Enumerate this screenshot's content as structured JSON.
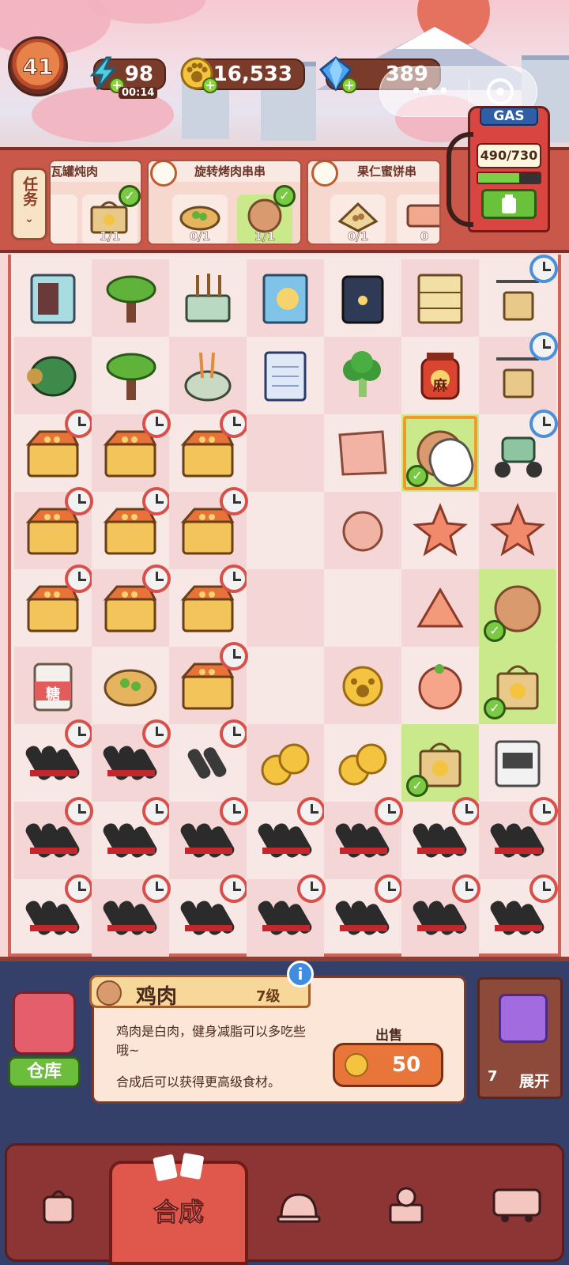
{
  "resources": {
    "level": "41",
    "energy": "98",
    "energy_timer": "00:14",
    "coins": "16,533",
    "gems": "389"
  },
  "gas": {
    "title": "GAS",
    "value": "490/730",
    "fill": 0.67
  },
  "tasks": {
    "tab_label": "任务",
    "orders": [
      {
        "name": "瓦罐炖肉",
        "slots": [
          {
            "count": "",
            "ready": false
          },
          {
            "count": "1/1",
            "ready": true
          }
        ]
      },
      {
        "name": "旋转烤肉串串",
        "slots": [
          {
            "count": "0/1",
            "ready": false
          },
          {
            "count": "1/1",
            "ready": true
          }
        ]
      },
      {
        "name": "果仁蜜饼串",
        "slots": [
          {
            "count": "0/1",
            "ready": false
          },
          {
            "count": "0",
            "ready": false
          }
        ]
      }
    ]
  },
  "board": {
    "rows": [
      [
        "fridge",
        "tree",
        "skewer-machine",
        "recipe-book",
        "chef-hat-box",
        "cabinet",
        "drone"
      ],
      [
        "barrel",
        "tree",
        "skewer-pot",
        "notepad",
        "broccoli",
        "jar",
        "drone"
      ],
      [
        "box",
        "box",
        "box",
        "",
        "meat-slice",
        "meatball-selected",
        "scooter"
      ],
      [
        "box",
        "box",
        "box",
        "",
        "meat-crumble",
        "star-meat",
        "star-meat"
      ],
      [
        "box",
        "box",
        "box",
        "",
        "",
        "triangle-meat",
        "meatball"
      ],
      [
        "sugar-jar",
        "bread",
        "box",
        "",
        "paw-coin",
        "shrimp-ball",
        "takeout-bag"
      ],
      [
        "film",
        "film",
        "film-small",
        "paw-coins",
        "paw-coins",
        "takeout-bag",
        "printer"
      ],
      [
        "film",
        "film",
        "film",
        "film",
        "film",
        "film",
        "film"
      ],
      [
        "film",
        "film",
        "film",
        "film",
        "film",
        "film",
        "film"
      ]
    ],
    "sugar_label": "糖",
    "jar_label": "麻"
  },
  "info": {
    "item_name": "鸡肉",
    "item_level": "7级",
    "desc": "鸡肉是白肉，健身减脂可以多吃些哦~",
    "desc2": "合成后可以获得更高级食材。",
    "sell_label": "出售",
    "sell_price": "50",
    "storage_label": "仓库",
    "expand_count": "7",
    "expand_label": "展开"
  },
  "nav": {
    "active_label": "合成"
  },
  "colors": {
    "board_border": "#d0635a",
    "ready_green": "#c9e98a",
    "panel_bg": "#35406a"
  }
}
